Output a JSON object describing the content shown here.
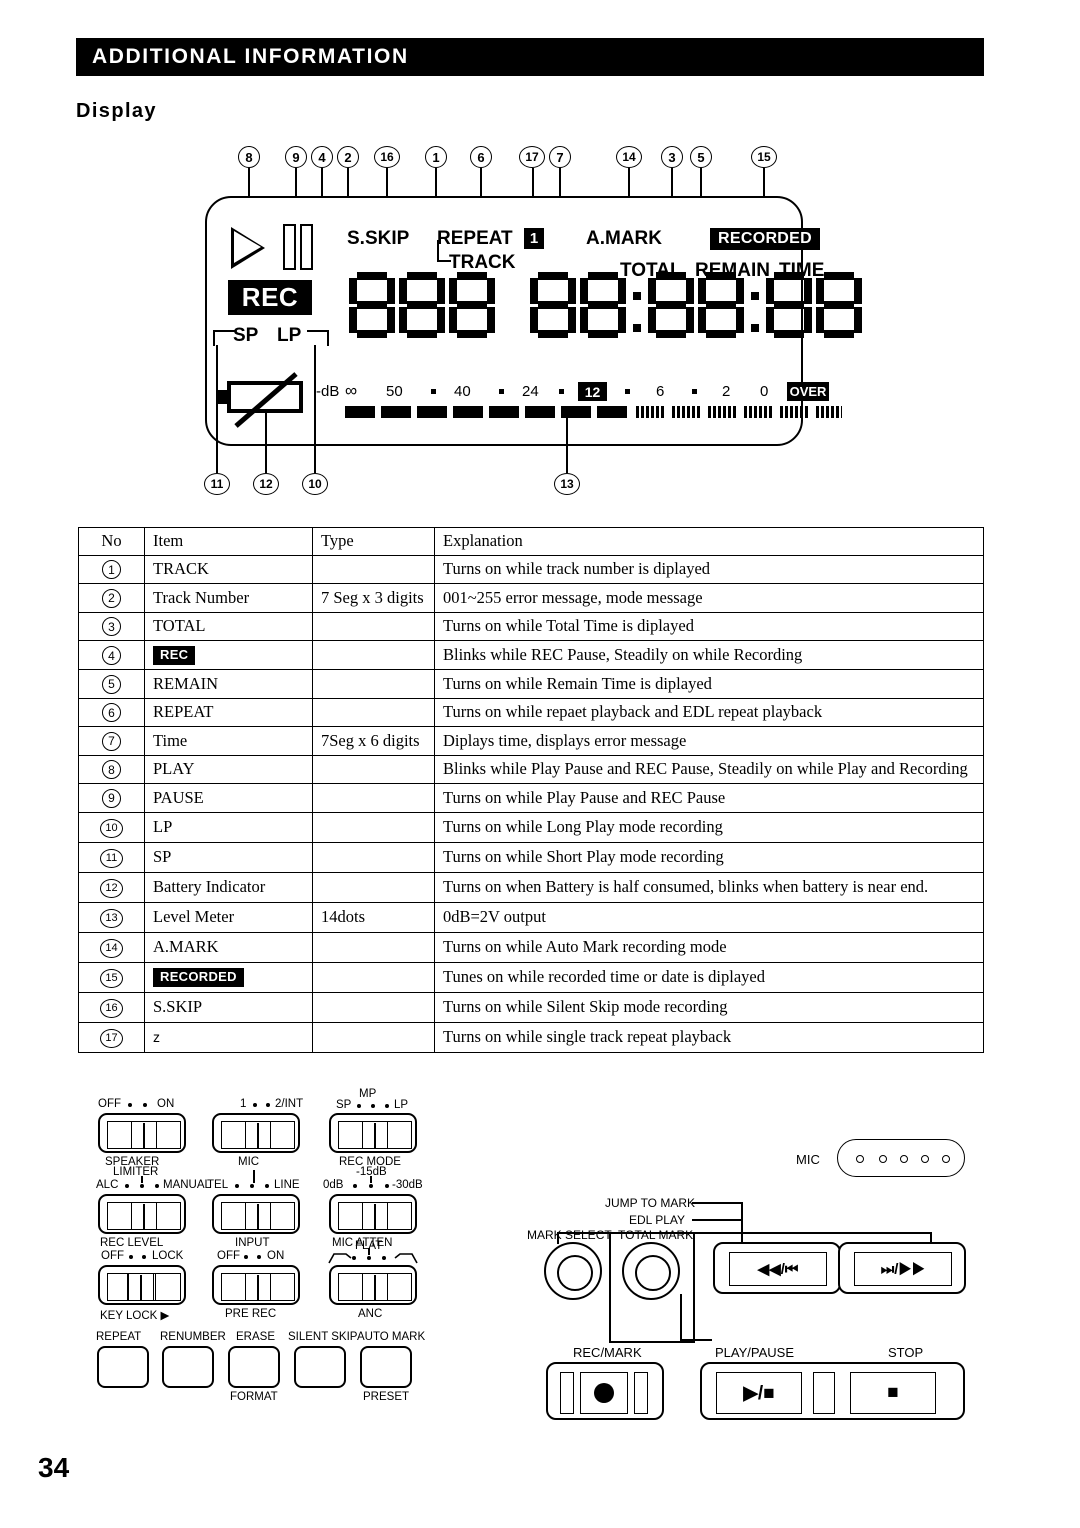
{
  "header": {
    "title": "ADDITIONAL INFORMATION"
  },
  "section": {
    "title": "Display"
  },
  "page": {
    "number": "34"
  },
  "display_panel": {
    "callouts_top": [
      "8",
      "9",
      "4",
      "2",
      "16",
      "1",
      "6",
      "17",
      "7",
      "14",
      "3",
      "5",
      "15"
    ],
    "callouts_bottom": [
      "11",
      "12",
      "10",
      "13"
    ],
    "indicators": {
      "play": "play-triangle",
      "pause": "pause-bars",
      "rec": "REC",
      "sp": "SP",
      "lp": "LP",
      "s_skip": "S.SKIP",
      "repeat": "REPEAT",
      "repeat_one": "1",
      "track": "TRACK",
      "a_mark": "A.MARK",
      "recorded": "RECORDED",
      "total": "TOTAL",
      "remain": "REMAIN",
      "time": "TIME"
    },
    "track_digits": "888",
    "time_digits": "88:88:88",
    "level_meter": {
      "unit": "-dB",
      "scale": [
        "∞",
        "50",
        "·",
        "40",
        "·",
        "24",
        "·",
        "12",
        "·",
        "6",
        "·",
        "2",
        "0"
      ],
      "over_label": "OVER",
      "solid_segments": 8,
      "striped_segments": 6
    }
  },
  "table": {
    "columns": [
      "No",
      "Item",
      "Type",
      "Explanation"
    ],
    "rows": [
      {
        "no": "1",
        "item": "TRACK",
        "type": "",
        "explanation": "Turns on while track number is diplayed"
      },
      {
        "no": "2",
        "item": "Track Number",
        "type": "7 Seg x 3 digits",
        "explanation": "001~255 error message, mode message"
      },
      {
        "no": "3",
        "item": "TOTAL",
        "type": "",
        "explanation": "Turns on while Total Time is diplayed"
      },
      {
        "no": "4",
        "item": "REC",
        "type": "",
        "explanation": "Blinks while REC Pause, Steadily on while Recording",
        "item_style": "inverse"
      },
      {
        "no": "5",
        "item": "REMAIN",
        "type": "",
        "explanation": "Turns on while Remain Time is diplayed"
      },
      {
        "no": "6",
        "item": "REPEAT",
        "type": "",
        "explanation": "Turns on while repaet playback and EDL repeat playback"
      },
      {
        "no": "7",
        "item": "Time",
        "type": "7Seg x 6 digits",
        "explanation": "Diplays time, displays error message"
      },
      {
        "no": "8",
        "item": "PLAY",
        "type": "",
        "explanation": "Blinks while Play Pause and REC Pause, Steadily on while Play and Recording",
        "small": true
      },
      {
        "no": "9",
        "item": "PAUSE",
        "type": "",
        "explanation": "Turns on while Play Pause and REC Pause"
      },
      {
        "no": "10",
        "item": "LP",
        "type": "",
        "explanation": "Turns on while Long Play mode recording"
      },
      {
        "no": "11",
        "item": "SP",
        "type": "",
        "explanation": "Turns on while Short Play mode recording"
      },
      {
        "no": "12",
        "item": "Battery Indicator",
        "type": "",
        "explanation": "Turns on when Battery is half consumed, blinks when battery is near end.",
        "small": true
      },
      {
        "no": "13",
        "item": "Level Meter",
        "type": "14dots",
        "explanation": "0dB=2V output"
      },
      {
        "no": "14",
        "item": "A.MARK",
        "type": "",
        "explanation": "Turns on while Auto Mark recording mode"
      },
      {
        "no": "15",
        "item": "RECORDED",
        "type": "",
        "explanation": "Tunes on while recorded time or date is diplayed",
        "item_style": "inverse"
      },
      {
        "no": "16",
        "item": "S.SKIP",
        "type": "",
        "explanation": "Turns on while Silent Skip mode recording"
      },
      {
        "no": "17",
        "item": "z",
        "type": "",
        "explanation": "Turns on while single track repeat playback",
        "item_style": "mono"
      }
    ]
  },
  "controls": {
    "switches": [
      {
        "name": "speaker",
        "above_left": "OFF",
        "above_right": "ON",
        "below": "SPEAKER"
      },
      {
        "name": "mic",
        "above_left": "1",
        "above_right": "2/INT",
        "below": "MIC"
      },
      {
        "name": "rec_mode",
        "above_left": "SP",
        "above_mid": "MP",
        "above_right": "LP",
        "below": "REC MODE"
      },
      {
        "name": "rec_level",
        "above_top": "LIMITER",
        "above_left": "ALC",
        "above_right": "MANUAL",
        "below": "REC LEVEL"
      },
      {
        "name": "input",
        "above_left": "TEL",
        "above_right": "LINE",
        "below": "INPUT"
      },
      {
        "name": "mic_atten",
        "above_mid": "-15dB",
        "above_left": "0dB",
        "above_right": "-30dB",
        "below": "MIC ATTEN"
      },
      {
        "name": "key_lock",
        "above_left": "OFF",
        "above_right": "LOCK",
        "below": "KEY LOCK ▶"
      },
      {
        "name": "pre_rec",
        "above_left": "OFF",
        "above_right": "ON",
        "below": "PRE REC"
      },
      {
        "name": "anc",
        "above_mid": "FLAT",
        "below": "ANC"
      }
    ],
    "buttons_row": [
      {
        "label": "REPEAT",
        "sub": ""
      },
      {
        "label": "RENUMBER",
        "sub": ""
      },
      {
        "label": "ERASE",
        "sub": "FORMAT"
      },
      {
        "label": "SILENT SKIP",
        "sub": ""
      },
      {
        "label": "AUTO MARK",
        "sub": "PRESET"
      }
    ],
    "right": {
      "mic_label": "MIC",
      "mark_select": "MARK SELECT",
      "total_mark": "TOTAL MARK",
      "edl_play": "EDL PLAY",
      "jump_to_mark": "JUMP TO MARK",
      "rec_mark": "REC/MARK",
      "play_pause": "PLAY/PAUSE",
      "stop": "STOP",
      "rew_label": "◀◀/⏮",
      "ff_label": "⏭/▶▶",
      "play_pause_glyph": "▶/■",
      "stop_glyph": "■",
      "rec_glyph": "●"
    }
  }
}
